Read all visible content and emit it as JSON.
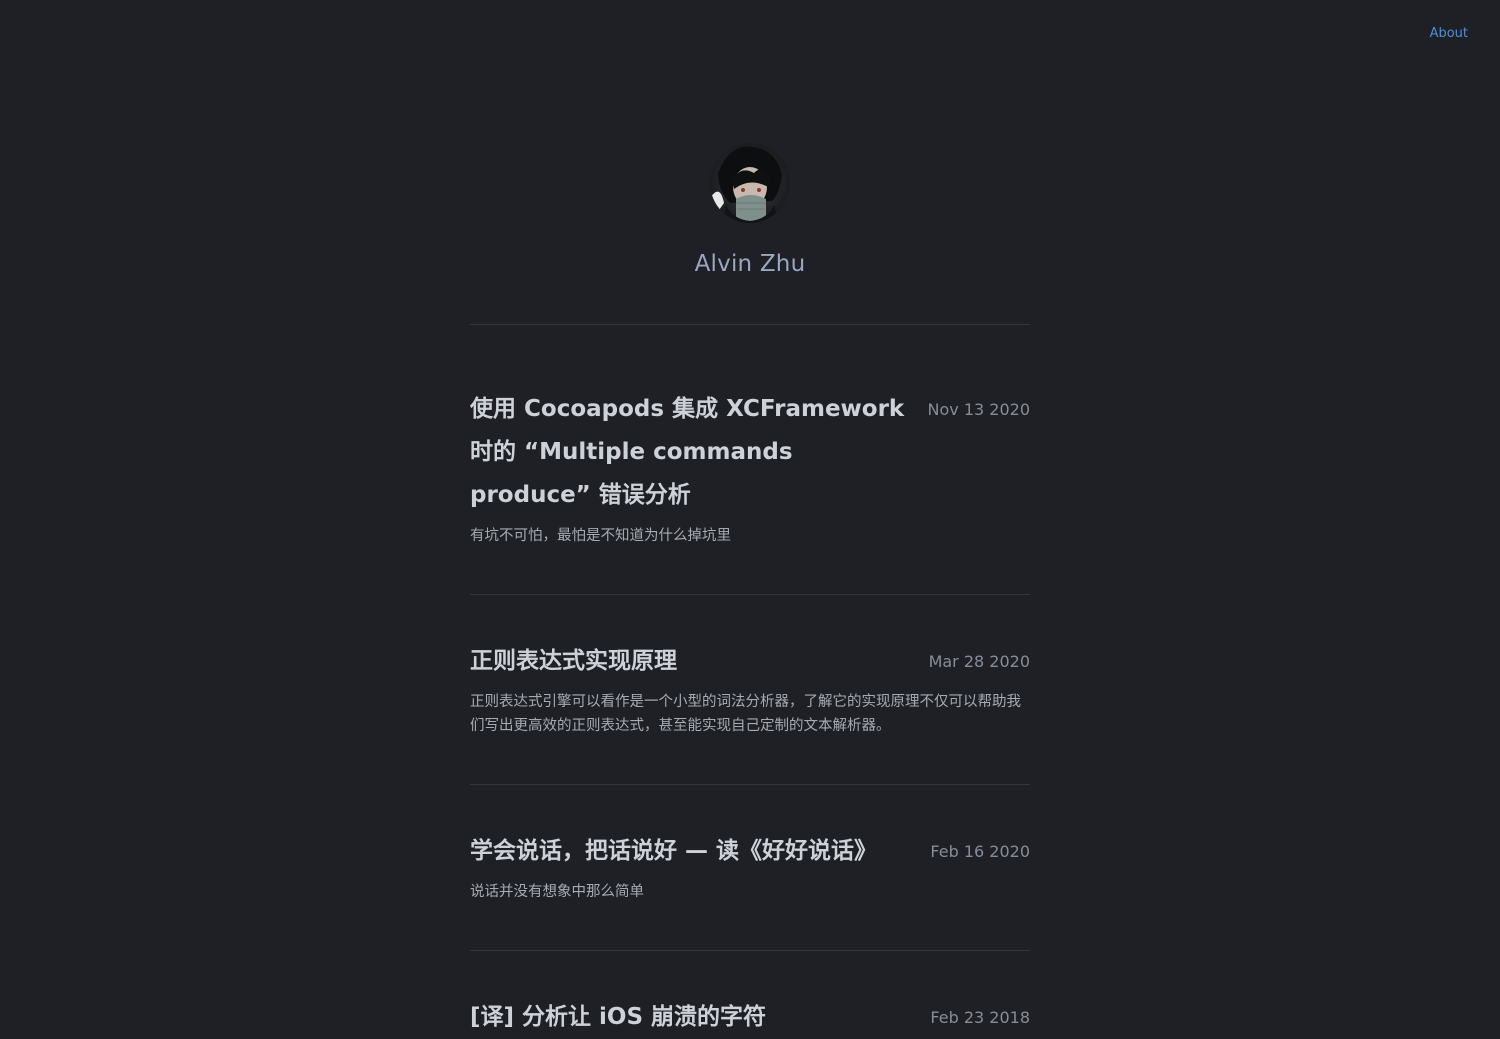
{
  "nav": {
    "about_label": "About"
  },
  "profile": {
    "name": "Alvin Zhu"
  },
  "posts": [
    {
      "title": "使用 Cocoapods 集成 XCFramework 时的 “Multiple commands produce” 错误分析",
      "date": "Nov 13 2020",
      "description": "有坑不可怕，最怕是不知道为什么掉坑里"
    },
    {
      "title": "正则表达式实现原理",
      "date": "Mar 28 2020",
      "description": "正则表达式引擎可以看作是一个小型的词法分析器，了解它的实现原理不仅可以帮助我们写出更高效的正则表达式，甚至能实现自己定制的文本解析器。"
    },
    {
      "title": "学会说话，把话说好 — 读《好好说话》",
      "date": "Feb 16 2020",
      "description": "说话并没有想象中那么简单"
    },
    {
      "title": "[译] 分析让 iOS 崩溃的字符",
      "date": "Feb 23 2018",
      "description": ""
    }
  ]
}
